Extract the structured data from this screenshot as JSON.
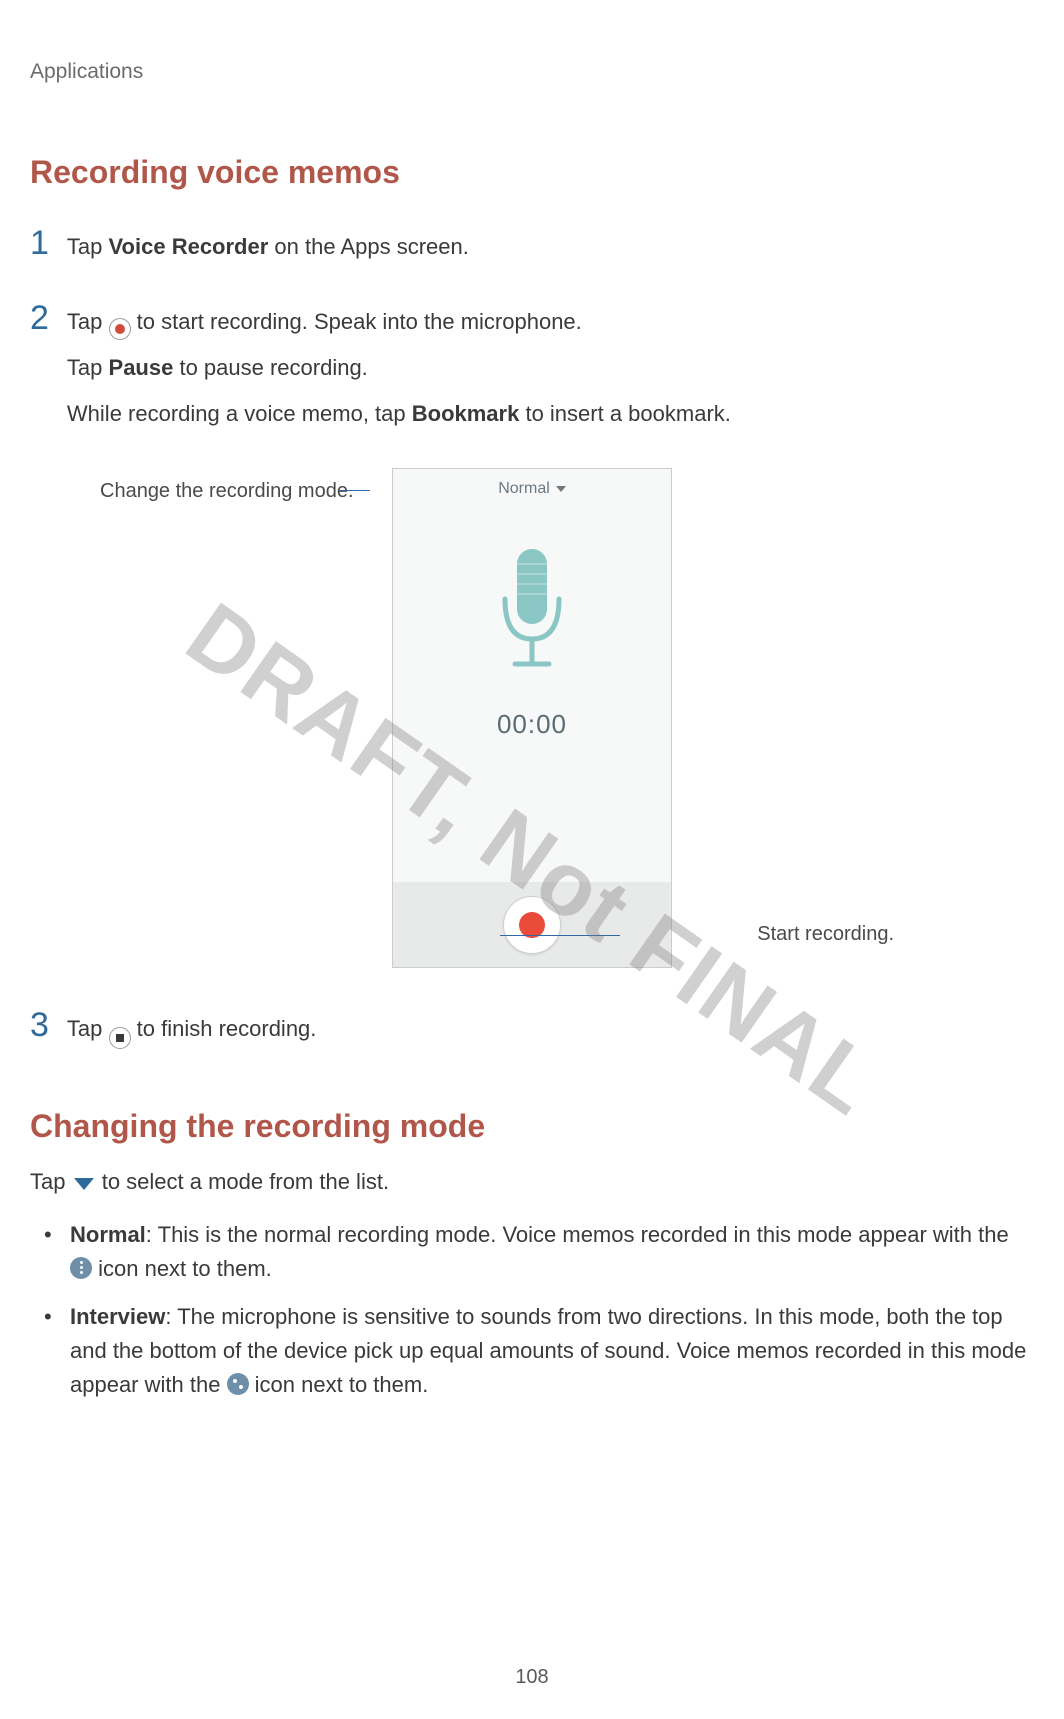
{
  "header": {
    "title": "Applications"
  },
  "section1": {
    "heading": "Recording voice memos"
  },
  "steps": {
    "s1": {
      "num": "1",
      "prefix": "Tap ",
      "bold": "Voice Recorder",
      "suffix": " on the Apps screen."
    },
    "s2": {
      "num": "2",
      "line1_prefix": "Tap ",
      "line1_suffix": " to start recording. Speak into the microphone.",
      "line2_prefix": "Tap ",
      "line2_bold": "Pause",
      "line2_suffix": " to pause recording.",
      "line3_prefix": "While recording a voice memo, tap ",
      "line3_bold": "Bookmark",
      "line3_suffix": " to insert a bookmark."
    },
    "s3": {
      "num": "3",
      "prefix": "Tap ",
      "suffix": " to finish recording."
    }
  },
  "figure": {
    "callout_left": "Change the recording mode.",
    "callout_right": "Start recording.",
    "mode_label": "Normal",
    "timer": "00:00"
  },
  "section2": {
    "heading": "Changing the recording mode",
    "intro_prefix": "Tap ",
    "intro_suffix": " to select a mode from the list."
  },
  "bullets": {
    "b1": {
      "bold": "Normal",
      "rest_a": ": This is the normal recording mode. Voice memos recorded in this mode appear with the ",
      "rest_b": " icon next to them."
    },
    "b2": {
      "bold": "Interview",
      "rest_a": ": The microphone is sensitive to sounds from two directions. In this mode, both the top and the bottom of the device pick up equal amounts of sound. Voice memos recorded in this mode appear with the ",
      "rest_b": " icon next to them."
    }
  },
  "page_number": "108",
  "watermark": "DRAFT, Not FINAL"
}
